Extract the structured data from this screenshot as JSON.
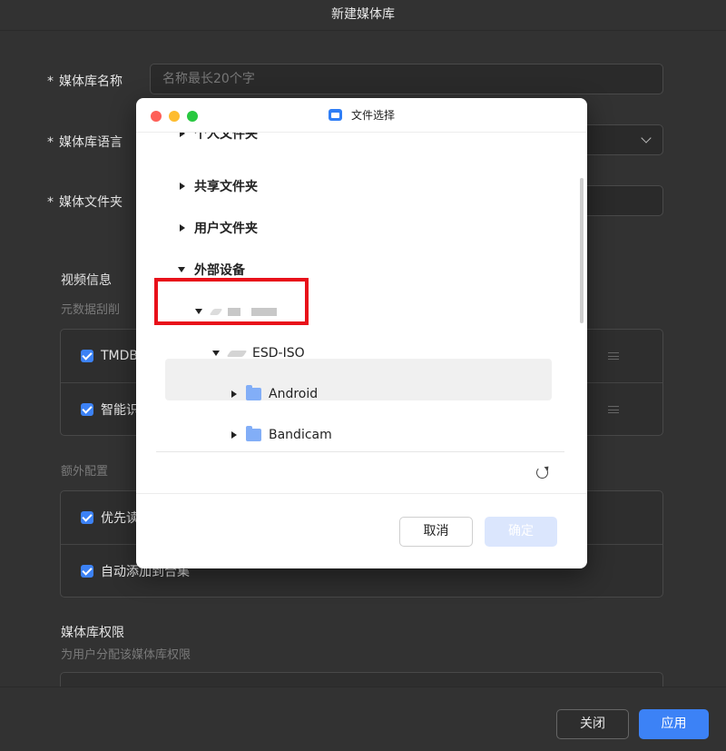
{
  "page": {
    "title": "新建媒体库"
  },
  "form": {
    "required_mark": "*",
    "name_label": "媒体库名称",
    "name_placeholder": "名称最长20个字",
    "language_label": "媒体库语言",
    "folder_label": "媒体文件夹"
  },
  "video_info": {
    "title": "视频信息",
    "subtitle": "元数据刮削",
    "items": [
      {
        "label": "TMDB",
        "checked": true
      },
      {
        "label": "智能识",
        "checked": true
      }
    ]
  },
  "extra": {
    "title": "额外配置",
    "items": [
      {
        "label": "优先读",
        "checked": true
      },
      {
        "label": "自动添加到合集",
        "checked": true
      }
    ]
  },
  "permissions": {
    "title": "媒体库权限",
    "subtitle": "为用户分配该媒体库权限"
  },
  "footer": {
    "close_label": "关闭",
    "apply_label": "应用"
  },
  "modal": {
    "title": "文件选择",
    "traffic_lights": {
      "close_color": "#fe5f57",
      "minimize_color": "#febc2e",
      "zoom_color": "#28c840"
    },
    "tree": [
      {
        "label": "个人文件夹",
        "expanded": false
      },
      {
        "label": "共享文件夹",
        "expanded": false
      },
      {
        "label": "用户文件夹",
        "expanded": false
      },
      {
        "label": "外部设备",
        "expanded": true,
        "highlighted": true
      },
      {
        "label": "",
        "expanded": true,
        "icon": "drive-icon"
      },
      {
        "label": "ESD-ISO",
        "expanded": true,
        "icon": "drive-icon",
        "selected": true
      },
      {
        "label": "Android",
        "expanded": false,
        "icon": "folder-icon"
      },
      {
        "label": "Bandicam",
        "expanded": false,
        "icon": "folder-icon"
      }
    ],
    "cancel_label": "取消",
    "confirm_label": "确定",
    "confirm_enabled": false
  },
  "colors": {
    "accent": "#3c82f6",
    "highlight_border": "#e8101a",
    "folder": "#82aef7"
  }
}
